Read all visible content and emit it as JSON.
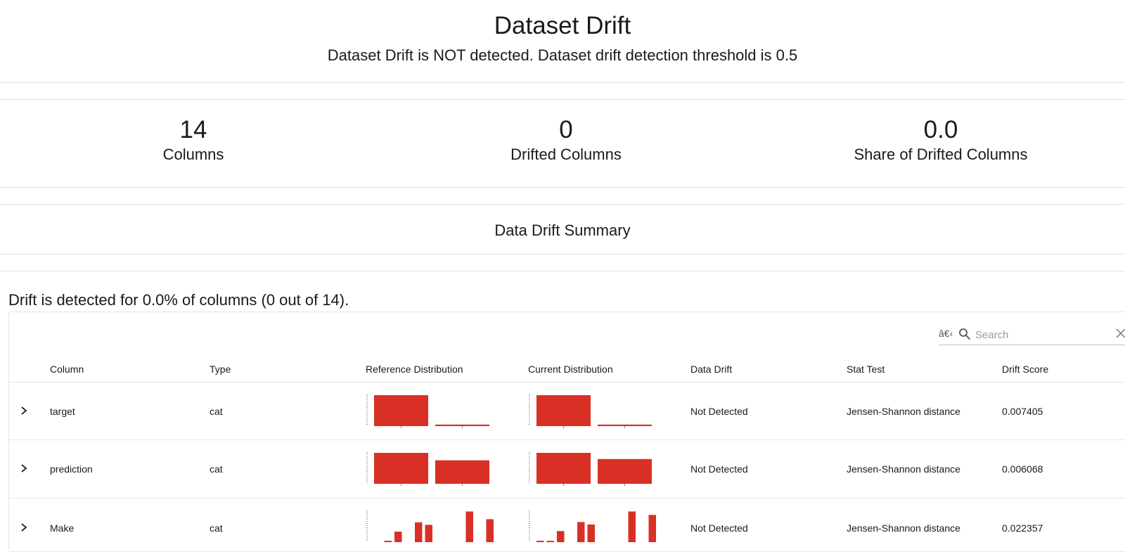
{
  "header": {
    "title": "Dataset Drift",
    "subtitle": "Dataset Drift is NOT detected. Dataset drift detection threshold is 0.5"
  },
  "metrics": [
    {
      "value": "14",
      "label": "Columns"
    },
    {
      "value": "0",
      "label": "Drifted Columns"
    },
    {
      "value": "0.0",
      "label": "Share of Drifted Columns"
    }
  ],
  "summary": {
    "title": "Data Drift Summary",
    "detected_text": "Drift is detected for 0.0% of columns (0 out of 14)."
  },
  "search": {
    "prefix": "â€‹",
    "placeholder": "Search",
    "value": ""
  },
  "table": {
    "columns": [
      "Column",
      "Type",
      "Reference Distribution",
      "Current Distribution",
      "Data Drift",
      "Stat Test",
      "Drift Score"
    ],
    "rows": [
      {
        "column": "target",
        "type": "cat",
        "data_drift": "Not Detected",
        "stat_test": "Jensen-Shannon distance",
        "drift_score": "0.007405"
      },
      {
        "column": "prediction",
        "type": "cat",
        "data_drift": "Not Detected",
        "stat_test": "Jensen-Shannon distance",
        "drift_score": "0.006068"
      },
      {
        "column": "Make",
        "type": "cat",
        "data_drift": "Not Detected",
        "stat_test": "Jensen-Shannon distance",
        "drift_score": "0.022357"
      }
    ]
  },
  "chart_data": [
    {
      "type": "bar",
      "row": "target",
      "distribution": "reference",
      "values": [
        1.0,
        0.05
      ]
    },
    {
      "type": "bar",
      "row": "target",
      "distribution": "current",
      "values": [
        1.0,
        0.05
      ]
    },
    {
      "type": "bar",
      "row": "prediction",
      "distribution": "reference",
      "values": [
        1.0,
        0.76
      ]
    },
    {
      "type": "bar",
      "row": "prediction",
      "distribution": "current",
      "values": [
        1.0,
        0.8
      ]
    },
    {
      "type": "bar",
      "row": "Make",
      "distribution": "reference",
      "values": [
        0.0,
        0.03,
        0.34,
        0.0,
        0.64,
        0.56,
        0.0,
        0.0,
        0.0,
        0.99,
        0.0,
        0.74
      ]
    },
    {
      "type": "bar",
      "row": "Make",
      "distribution": "current",
      "values": [
        0.04,
        0.04,
        0.36,
        0.0,
        0.65,
        0.57,
        0.0,
        0.0,
        0.0,
        0.99,
        0.0,
        0.88
      ]
    }
  ],
  "colors": {
    "bar": "#d93025",
    "text": "#1a1a1a",
    "border": "#e3e3e3"
  }
}
